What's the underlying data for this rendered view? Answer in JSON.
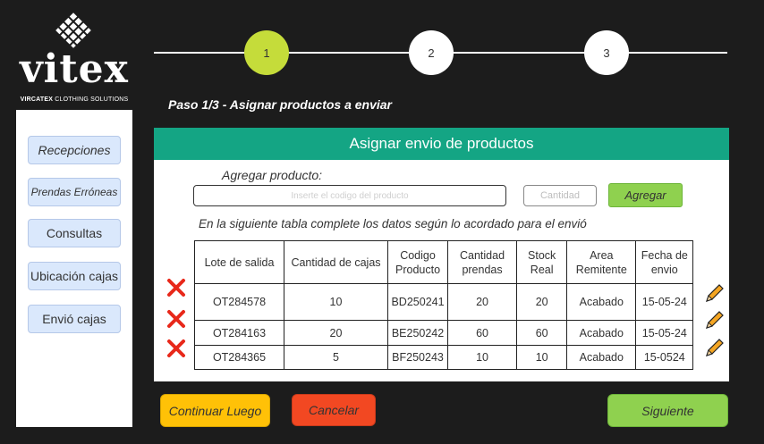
{
  "brand": {
    "name": "vitex",
    "tagline_bold": "VIRCATEX",
    "tagline_rest": " CLOTHING SOLUTIONS"
  },
  "sidebar": {
    "items": [
      {
        "label": "Recepciones"
      },
      {
        "label": "Prendas Erróneas"
      },
      {
        "label": "Consultas"
      },
      {
        "label": "Ubicación cajas"
      },
      {
        "label": "Envió cajas"
      }
    ]
  },
  "stepper": {
    "steps": [
      "1",
      "2",
      "3"
    ],
    "active_step": "1",
    "title": "Paso 1/3 - Asignar productos a enviar"
  },
  "panel": {
    "header": "Asignar envio de productos",
    "add_label": "Agregar producto:",
    "code_placeholder": "Inserte el codigo del producto",
    "qty_placeholder": "Cantidad",
    "add_button": "Agregar",
    "instructions": "En la siguiente tabla complete los datos según lo acordado para el envió"
  },
  "table": {
    "headers": [
      "Lote de salida",
      "Cantidad de cajas",
      "Codigo Producto",
      "Cantidad prendas",
      "Stock Real",
      "Area Remitente",
      "Fecha de envio"
    ],
    "rows": [
      [
        "OT284578",
        "10",
        "BD250241",
        "20",
        "20",
        "Acabado",
        "15-05-24"
      ],
      [
        "OT284163",
        "20",
        "BE250242",
        "60",
        "60",
        "Acabado",
        "15-05-24"
      ],
      [
        "OT284365",
        "5",
        "BF250243",
        "10",
        "10",
        "Acabado",
        "15-0524"
      ]
    ]
  },
  "actions": {
    "continue_later": "Continuar Luego",
    "cancel": "Cancelar",
    "next": "Siguiente"
  },
  "colors": {
    "background": "#1c1c1c",
    "header_green": "#14a584",
    "active_step": "#c5dc3a",
    "button_green": "#8fd14f",
    "button_yellow": "#ffc107",
    "button_red": "#f24822",
    "sidebar_button": "#dae8fc",
    "delete_icon": "#e8281a",
    "edit_icon": "#f5a623"
  },
  "icons": {
    "delete": "close-x-icon",
    "edit": "pencil-icon",
    "logo": "woven-diamond-icon"
  }
}
